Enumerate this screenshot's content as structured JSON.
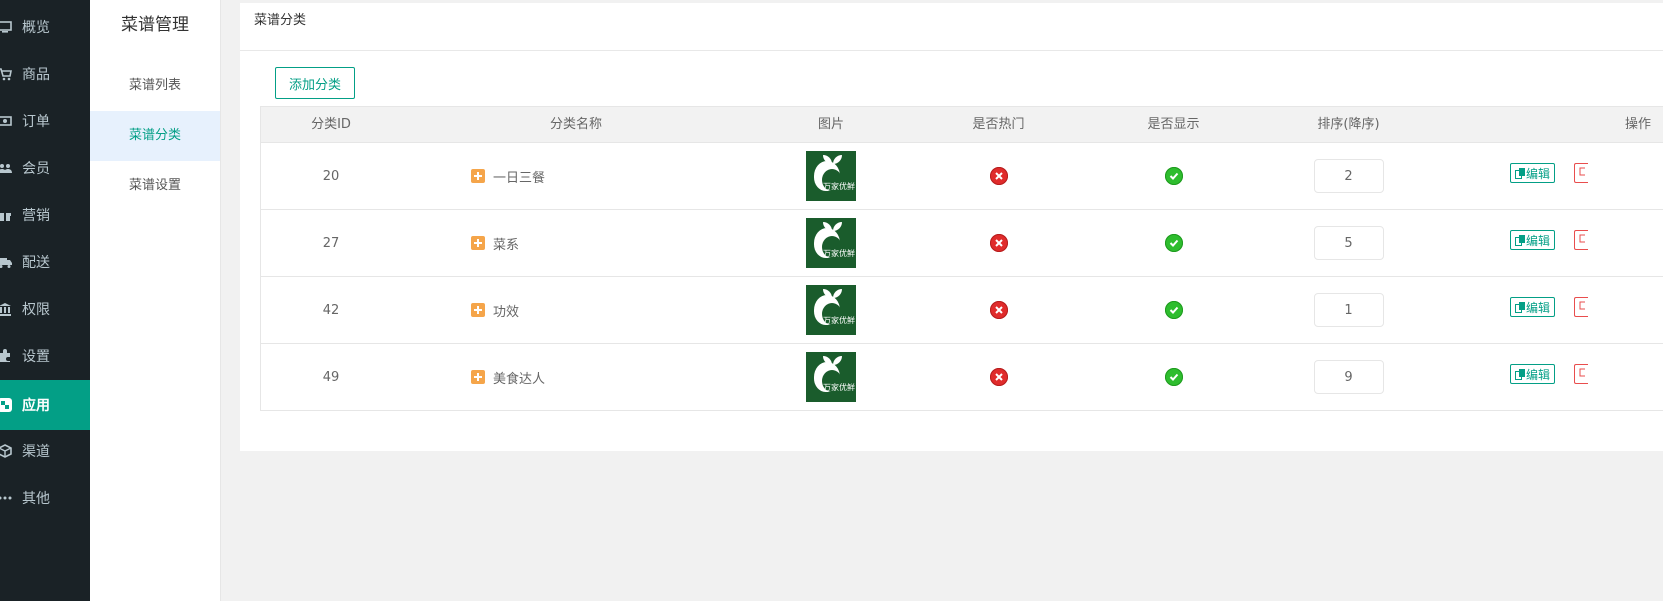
{
  "nav": {
    "items": [
      {
        "label": "概览",
        "icon": "monitor-icon"
      },
      {
        "label": "商品",
        "icon": "cart-icon"
      },
      {
        "label": "订单",
        "icon": "money-icon"
      },
      {
        "label": "会员",
        "icon": "users-icon"
      },
      {
        "label": "营销",
        "icon": "gift-icon"
      },
      {
        "label": "配送",
        "icon": "truck-icon"
      },
      {
        "label": "权限",
        "icon": "bank-icon"
      },
      {
        "label": "设置",
        "icon": "puzzle-icon"
      },
      {
        "label": "应用",
        "icon": "apps-icon"
      },
      {
        "label": "渠道",
        "icon": "cube-icon"
      },
      {
        "label": "其他",
        "icon": "ellipsis-icon"
      }
    ],
    "active": "应用"
  },
  "submenu": {
    "title": "菜谱管理",
    "items": [
      {
        "label": "菜谱列表"
      },
      {
        "label": "菜谱分类"
      },
      {
        "label": "菜谱设置"
      }
    ],
    "active": "菜谱分类"
  },
  "main": {
    "title": "菜谱分类",
    "add_button": "添加分类",
    "columns": [
      "分类ID",
      "分类名称",
      "图片",
      "是否热门",
      "是否显示",
      "排序(降序)",
      "操作"
    ],
    "image_brand": "万家优鲜",
    "edit_label": "编辑",
    "rows": [
      {
        "id": "20",
        "name": "一日三餐",
        "hot": false,
        "show": true,
        "sort": "2"
      },
      {
        "id": "27",
        "name": "菜系",
        "hot": false,
        "show": true,
        "sort": "5"
      },
      {
        "id": "42",
        "name": "功效",
        "hot": false,
        "show": true,
        "sort": "1"
      },
      {
        "id": "49",
        "name": "美食达人",
        "hot": false,
        "show": true,
        "sort": "9"
      }
    ]
  },
  "colors": {
    "accent": "#039f86",
    "nav_bg": "#1a2226",
    "danger": "#e02b2b",
    "success": "#2ebd2e",
    "expand": "#f5a54a"
  }
}
